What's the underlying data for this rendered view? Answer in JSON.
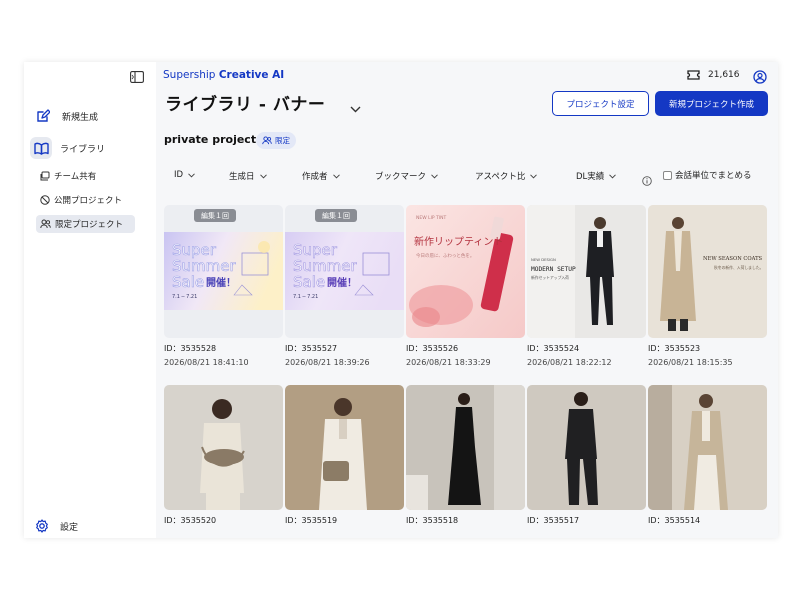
{
  "sidebar": {
    "collapse_icon": "sidebar-toggle-icon",
    "items": [
      {
        "label": "新規生成",
        "icon": "edit-icon"
      },
      {
        "label": "ライブラリ",
        "icon": "book-icon"
      }
    ],
    "sub_items": [
      {
        "label": "チーム共有",
        "icon": "folders-icon"
      },
      {
        "label": "公開プロジェクト",
        "icon": "globe-icon"
      },
      {
        "label": "限定プロジェクト",
        "icon": "users-icon"
      }
    ],
    "settings_label": "設定"
  },
  "header": {
    "brand_light": "Supership",
    "brand_bold": "Creative AI",
    "credits": "21,616",
    "title": "ライブラリ - バナー",
    "project_settings_label": "プロジェクト設定",
    "new_project_label": "新規プロジェクト作成"
  },
  "project": {
    "name": "private project",
    "badge": "限定"
  },
  "filters": {
    "items": [
      "ID",
      "生成日",
      "作成者",
      "ブックマーク",
      "アスペクト比",
      "DL実績"
    ],
    "group_label": "会話単位でまとめる"
  },
  "cards": [
    {
      "id": "ID：3535528",
      "date": "2026/08/21 18:41:10",
      "edit_tag": "編集１回",
      "image": "summer-sale-banner"
    },
    {
      "id": "ID：3535527",
      "date": "2026/08/21 18:39:26",
      "edit_tag": "編集１回",
      "image": "summer-sale-banner-purple"
    },
    {
      "id": "ID：3535526",
      "date": "2026/08/21 18:33:29",
      "image": "new-lip-tint-banner"
    },
    {
      "id": "ID：3535524",
      "date": "2026/08/21 18:22:12",
      "image": "modern-setup-banner"
    },
    {
      "id": "ID：3535523",
      "date": "2026/08/21 18:15:35",
      "image": "new-season-coats-banner"
    },
    {
      "id": "ID：3535520",
      "image": "woman-beige-outfit-photo"
    },
    {
      "id": "ID：3535519",
      "image": "woman-white-suit-photo"
    },
    {
      "id": "ID：3535518",
      "image": "woman-black-jumpsuit-photo"
    },
    {
      "id": "ID：3535517",
      "image": "man-black-suit-photo"
    },
    {
      "id": "ID：3535514",
      "image": "woman-beige-coat-photo"
    }
  ],
  "banner_text": {
    "super": "Super",
    "summer": "Summer",
    "sale": "Sale",
    "kaisai": "開催！",
    "dates": "7.1 ─ 7.21",
    "lip_small": "NEW LIP TINT",
    "lip_title": "新作リップティント",
    "lip_sub": "今日の唇に、ふわっと色を。",
    "modern_small": "NEW DESIGN",
    "modern_title": "MODERN SETUP",
    "modern_sub": "新作セットアップ入荷",
    "coats_title": "NEW SEASON COATS",
    "coats_sub": "秋冬の新作、入荷しました。"
  },
  "colors": {
    "accent": "#1438c4",
    "nav_active_bg": "#e6e9f0",
    "badge_bg": "#e3e8f7"
  }
}
